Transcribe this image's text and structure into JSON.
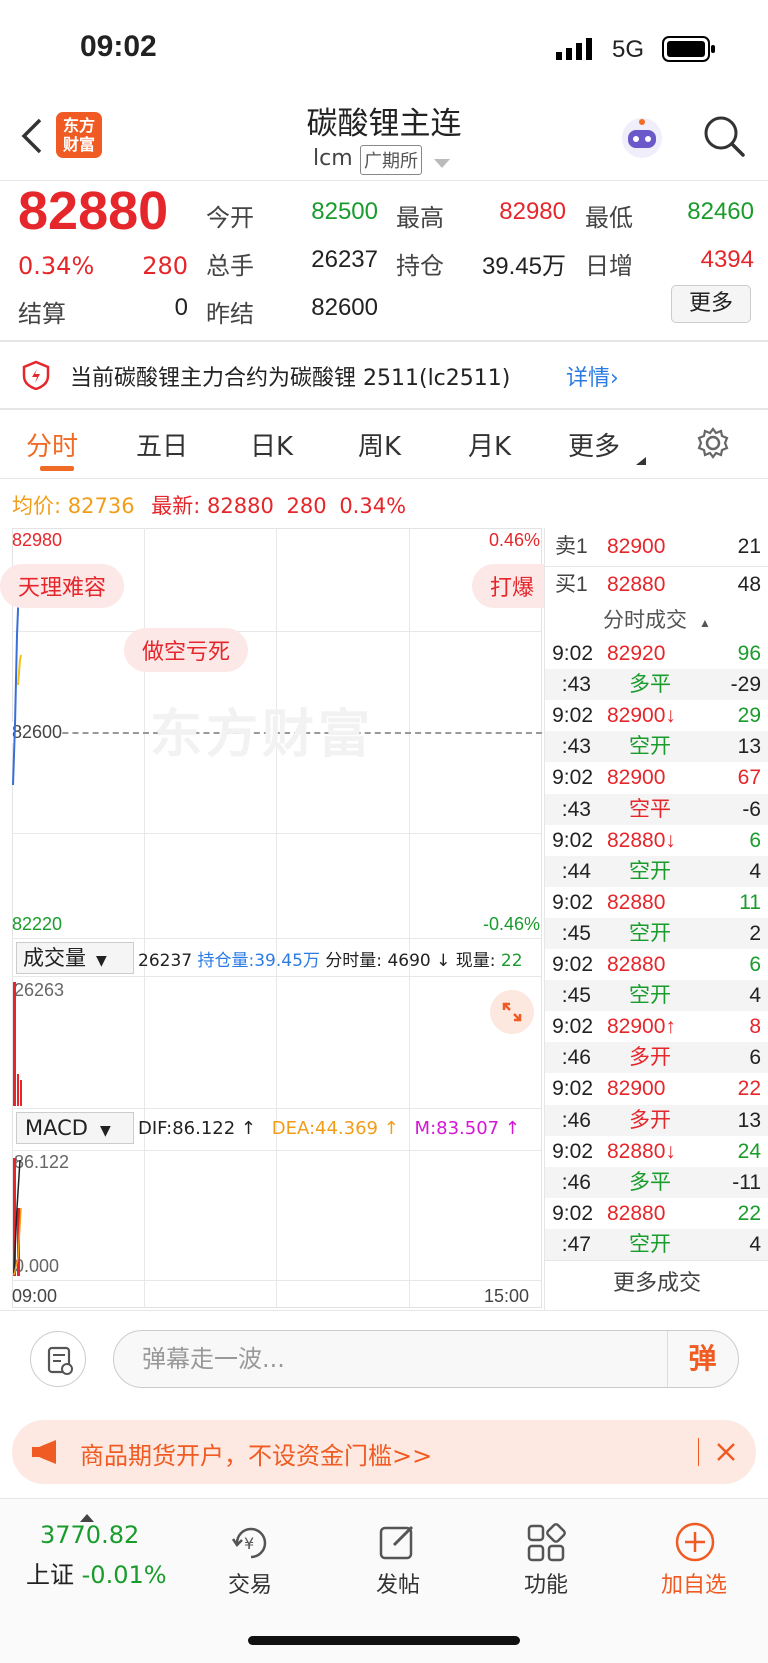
{
  "status_bar": {
    "time": "09:02",
    "network": "5G"
  },
  "header": {
    "title": "碳酸锂主连",
    "code": "lcm",
    "exchange": "广期所",
    "logo_text": "东方财富"
  },
  "quote": {
    "price": "82880",
    "change_pct": "0.34%",
    "change": "280",
    "labels": {
      "open": "今开",
      "high": "最高",
      "low": "最低",
      "volume": "总手",
      "position": "持仓",
      "daily_increase": "日增",
      "settle": "结算",
      "prev_settle": "昨结"
    },
    "open": "82500",
    "high": "82980",
    "low": "82460",
    "volume": "26237",
    "position": "39.45万",
    "daily_increase": "4394",
    "settle": "0",
    "prev_settle": "82600",
    "more_button": "更多"
  },
  "notice": {
    "text": "当前碳酸锂主力合约为碳酸锂 2511(lc2511)",
    "link": "详情"
  },
  "tabs": [
    "分时",
    "五日",
    "日K",
    "周K",
    "月K",
    "更多"
  ],
  "chart_info": {
    "avg_label": "均价:",
    "avg_value": "82736",
    "latest_label": "最新:",
    "latest_value": "82880",
    "latest_change": "280",
    "latest_pct": "0.34%"
  },
  "chart": {
    "y_top": "82980",
    "y_mid": "82600",
    "y_bottom": "82220",
    "pct_top": "0.46%",
    "pct_bottom": "-0.46%",
    "watermark": "东方财富",
    "x_start": "09:00",
    "x_end": "15:00",
    "danmu": [
      "天理难容",
      "做空亏死",
      "打爆"
    ]
  },
  "volume_panel": {
    "selector": "成交量",
    "total": "26237",
    "position_label": "持仓量:",
    "position_value": "39.45万",
    "minute_label": "分时量:",
    "minute_value": "4690 ↓",
    "current_label": "现量:",
    "current_value": "22",
    "max": "26263"
  },
  "macd_panel": {
    "selector": "MACD",
    "dif": "DIF:86.122 ↑",
    "dea": "DEA:44.369 ↑",
    "m": "M:83.507 ↑",
    "top": "86.122",
    "bottom": "0.000"
  },
  "order_book": [
    {
      "label": "卖1",
      "price": "82900",
      "qty": "21"
    },
    {
      "label": "买1",
      "price": "82880",
      "qty": "48"
    }
  ],
  "trades_header": "分时成交",
  "trades": [
    {
      "time": "9:02",
      "price": "82920",
      "qty": "96",
      "price_color": "#e5262b",
      "qty_color": "#1a9c2c"
    },
    {
      "time": ":43",
      "price": "多平",
      "qty": "-29",
      "price_color": "#1a9c2c",
      "qty_color": "#222"
    },
    {
      "time": "9:02",
      "price": "82900↓",
      "qty": "29",
      "price_color": "#e5262b",
      "qty_color": "#1a9c2c"
    },
    {
      "time": ":43",
      "price": "空开",
      "qty": "13",
      "price_color": "#1a9c2c",
      "qty_color": "#222"
    },
    {
      "time": "9:02",
      "price": "82900",
      "qty": "67",
      "price_color": "#e5262b",
      "qty_color": "#e5262b"
    },
    {
      "time": ":43",
      "price": "空平",
      "qty": "-6",
      "price_color": "#e5262b",
      "qty_color": "#222"
    },
    {
      "time": "9:02",
      "price": "82880↓",
      "qty": "6",
      "price_color": "#e5262b",
      "qty_color": "#1a9c2c"
    },
    {
      "time": ":44",
      "price": "空开",
      "qty": "4",
      "price_color": "#1a9c2c",
      "qty_color": "#222"
    },
    {
      "time": "9:02",
      "price": "82880",
      "qty": "11",
      "price_color": "#e5262b",
      "qty_color": "#1a9c2c"
    },
    {
      "time": ":45",
      "price": "空开",
      "qty": "2",
      "price_color": "#1a9c2c",
      "qty_color": "#222"
    },
    {
      "time": "9:02",
      "price": "82880",
      "qty": "6",
      "price_color": "#e5262b",
      "qty_color": "#1a9c2c"
    },
    {
      "time": ":45",
      "price": "空开",
      "qty": "4",
      "price_color": "#1a9c2c",
      "qty_color": "#222"
    },
    {
      "time": "9:02",
      "price": "82900↑",
      "qty": "8",
      "price_color": "#e5262b",
      "qty_color": "#e5262b"
    },
    {
      "time": ":46",
      "price": "多开",
      "qty": "6",
      "price_color": "#e5262b",
      "qty_color": "#222"
    },
    {
      "time": "9:02",
      "price": "82900",
      "qty": "22",
      "price_color": "#e5262b",
      "qty_color": "#e5262b"
    },
    {
      "time": ":46",
      "price": "多开",
      "qty": "13",
      "price_color": "#e5262b",
      "qty_color": "#222"
    },
    {
      "time": "9:02",
      "price": "82880↓",
      "qty": "24",
      "price_color": "#e5262b",
      "qty_color": "#1a9c2c"
    },
    {
      "time": ":46",
      "price": "多平",
      "qty": "-11",
      "price_color": "#1a9c2c",
      "qty_color": "#222"
    },
    {
      "time": "9:02",
      "price": "82880",
      "qty": "22",
      "price_color": "#e5262b",
      "qty_color": "#1a9c2c"
    },
    {
      "time": ":47",
      "price": "空开",
      "qty": "4",
      "price_color": "#1a9c2c",
      "qty_color": "#222"
    }
  ],
  "more_trades": "更多成交",
  "comment": {
    "placeholder": "弹幕走一波...",
    "send_label": "弹"
  },
  "promo": {
    "text": "商品期货开户，不设资金门槛>>"
  },
  "bottom_nav": {
    "index_value": "3770.82",
    "index_name": "上证",
    "index_change": "-0.01%",
    "items": [
      "交易",
      "发帖",
      "功能",
      "加自选"
    ]
  }
}
